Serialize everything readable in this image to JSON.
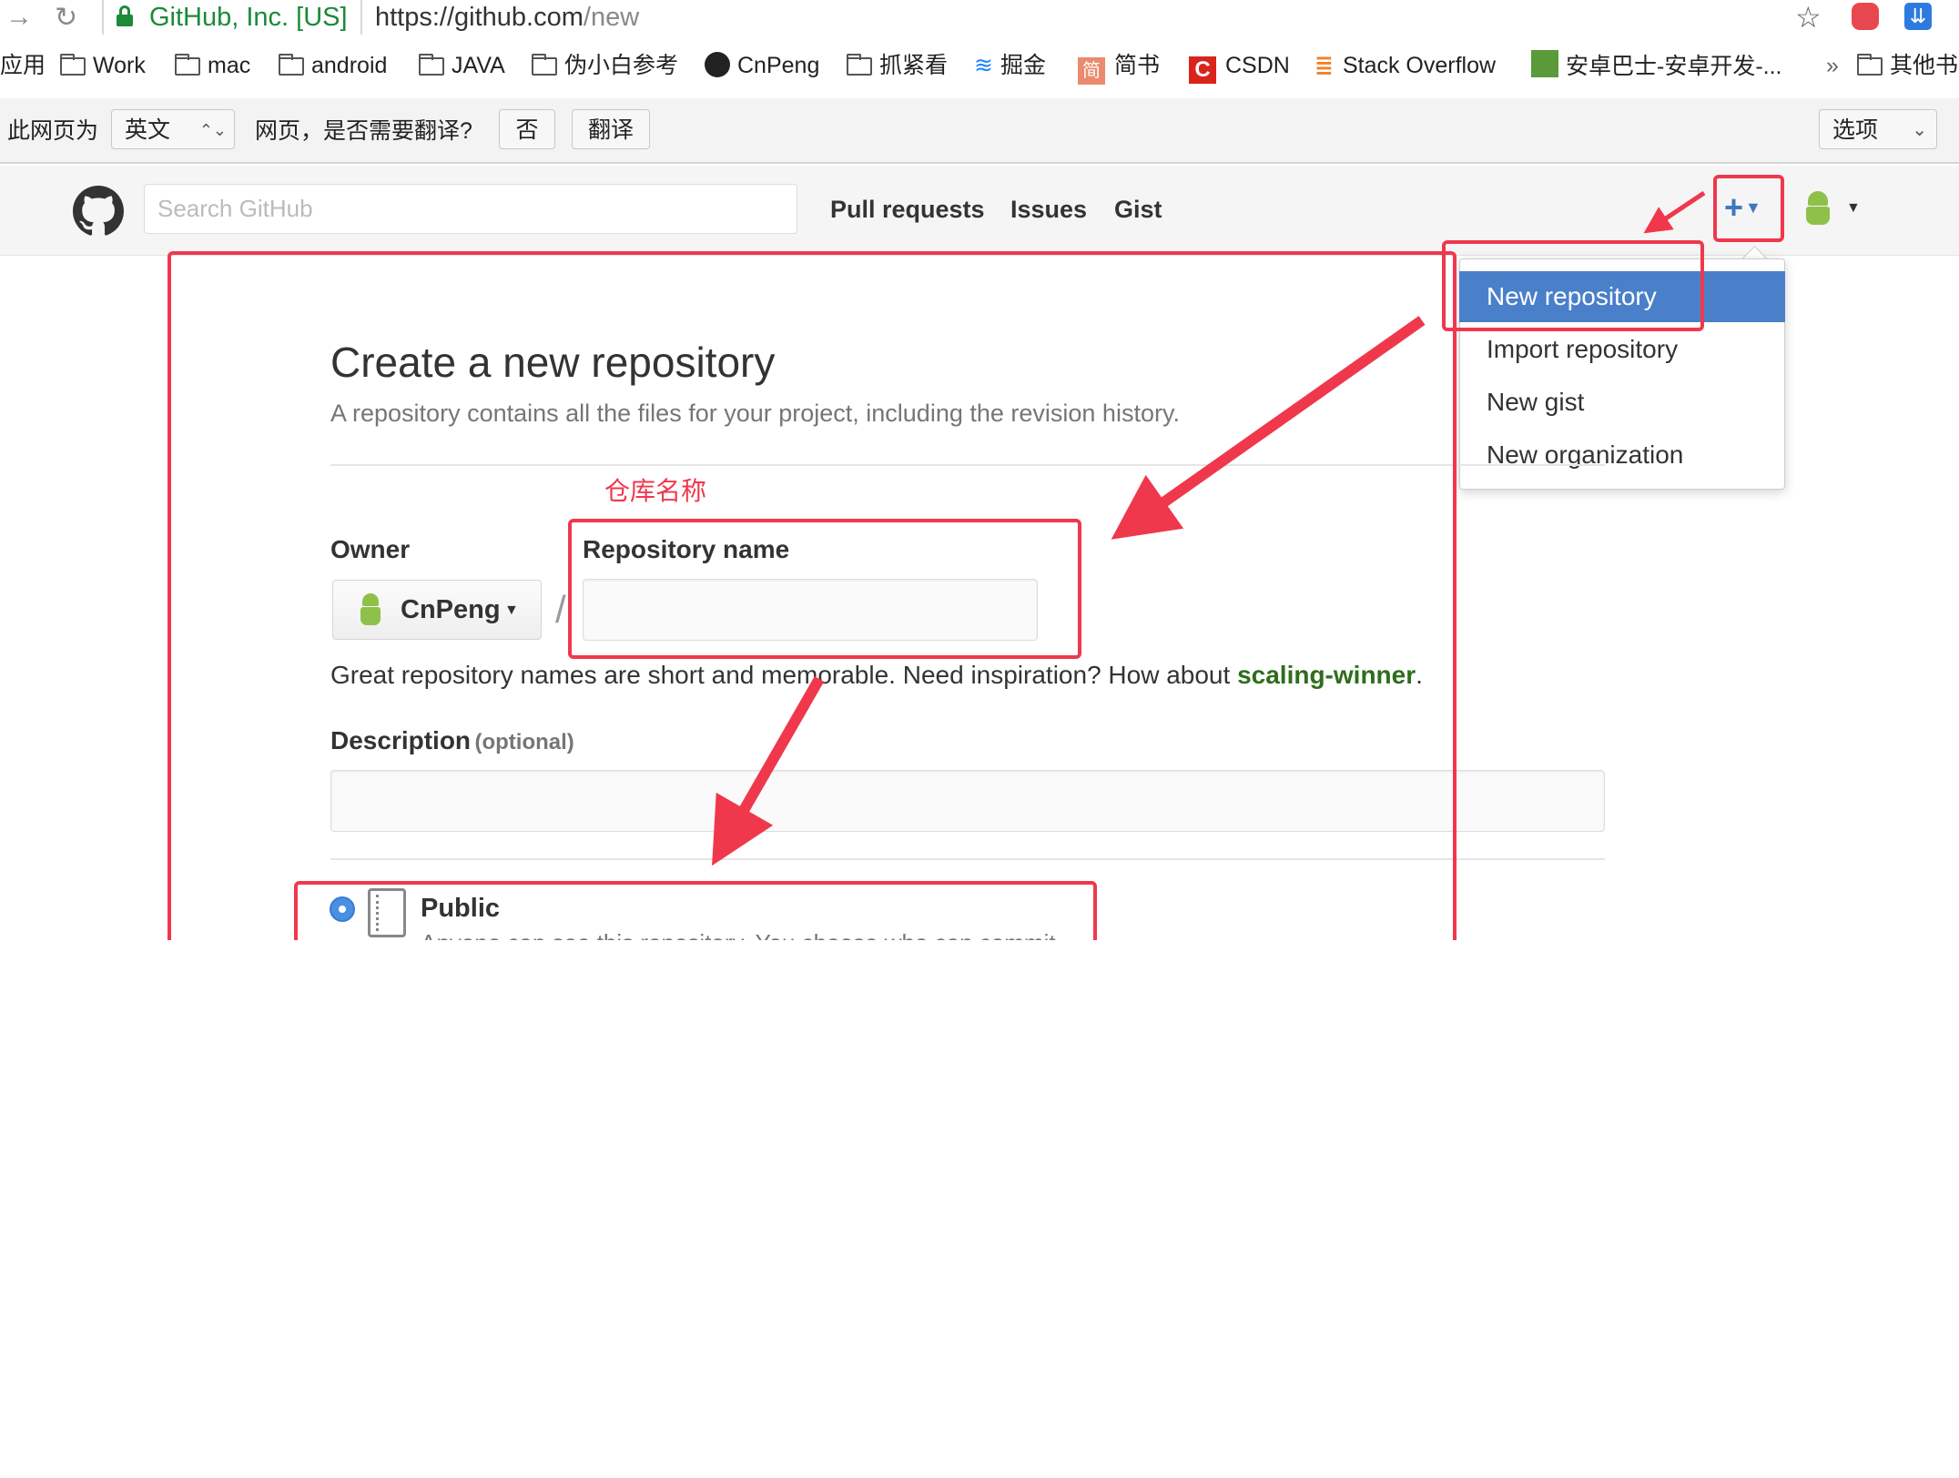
{
  "browser": {
    "identity": "GitHub, Inc. [US]",
    "url_host": "https://github.com",
    "url_path": "/new",
    "bookmarks": [
      "应用",
      "Work",
      "mac",
      "android",
      "JAVA",
      "伪小白参考",
      "CnPeng",
      "抓紧看",
      "掘金",
      "简书",
      "CSDN",
      "Stack Overflow",
      "安卓巴士-安卓开发-...",
      "»",
      "其他书"
    ],
    "translate": {
      "prefix": "此网页为",
      "language": "英文",
      "question": "网页，是否需要翻译?",
      "no_button": "否",
      "translate_button": "翻译",
      "options": "选项"
    }
  },
  "github": {
    "search_placeholder": "Search GitHub",
    "nav": [
      "Pull requests",
      "Issues",
      "Gist"
    ],
    "plus_label": "+",
    "new_menu": [
      "New repository",
      "Import repository",
      "New gist",
      "New organization"
    ]
  },
  "page": {
    "title": "Create a new repository",
    "subtitle": "A repository contains all the files for your project, including the revision history.",
    "owner_label": "Owner",
    "owner_value": "CnPeng",
    "separator": "/",
    "repo_label": "Repository name",
    "repo_value": "",
    "hint_prefix": "Great repository names are short and memorable. Need inspiration? How about ",
    "hint_suggestion": "scaling-winner",
    "hint_suffix": ".",
    "description_label": "Description",
    "description_optional": "(optional)",
    "description_value": "",
    "public_label": "Public",
    "public_desc": "Anyone can see this repository. You choose who can commit."
  },
  "annotation": {
    "repo_name_note": "仓库名称",
    "color": "#f0384c"
  },
  "colors": {
    "link_green": "#1c8a3a",
    "accent_blue": "#4078c0",
    "menu_highlight": "#4a7fc9",
    "suggestion_green": "#2e6d1c"
  }
}
